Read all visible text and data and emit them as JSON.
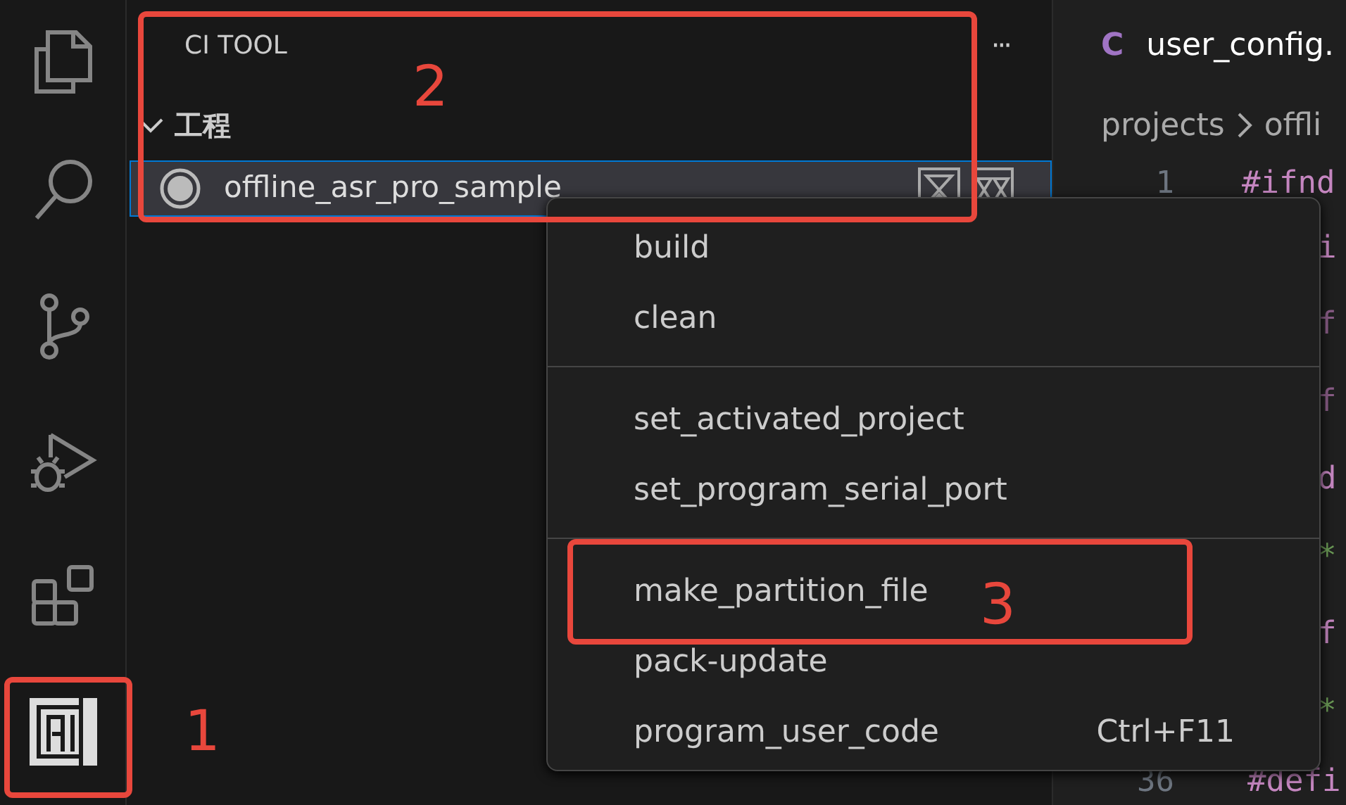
{
  "activity_bar": {
    "items": [
      {
        "kind": "files",
        "selected": false
      },
      {
        "kind": "search",
        "selected": false
      },
      {
        "kind": "source-control",
        "selected": false
      },
      {
        "kind": "run-debug",
        "selected": false
      },
      {
        "kind": "extensions",
        "selected": false
      },
      {
        "kind": "ci-tool",
        "selected": true
      }
    ]
  },
  "sidebar": {
    "title": "CI TOOL",
    "more": "···",
    "section": {
      "label": "工程",
      "expanded": true,
      "items": [
        {
          "label": "offline_asr_pro_sample",
          "selected": true
        }
      ]
    }
  },
  "editor": {
    "tab": {
      "icon": "C",
      "label": "user_config."
    },
    "breadcrumb": [
      "projects",
      "offli"
    ],
    "first_line": {
      "number": "1",
      "text": "#ifnd"
    },
    "fragments": [
      {
        "text": "i",
        "kind": "directive"
      },
      {
        "text": "f",
        "kind": "faded"
      },
      {
        "text": "f",
        "kind": "faded"
      },
      {
        "text": "d",
        "kind": "directive"
      },
      {
        "text": "*",
        "kind": "comment"
      },
      {
        "text": "f",
        "kind": "directive"
      },
      {
        "text": "*",
        "kind": "comment"
      },
      {
        "number": "36",
        "text": "#defi",
        "kind": "directive"
      }
    ]
  },
  "context_menu": {
    "groups": [
      [
        {
          "label": "build"
        },
        {
          "label": "clean"
        }
      ],
      [
        {
          "label": "set_activated_project"
        },
        {
          "label": "set_program_serial_port"
        }
      ],
      [
        {
          "label": "make_partition_file"
        },
        {
          "label": "pack-update"
        },
        {
          "label": "program_user_code",
          "shortcut": "Ctrl+F11"
        }
      ]
    ]
  },
  "annotations": [
    {
      "label": "1"
    },
    {
      "label": "2"
    },
    {
      "label": "3"
    }
  ]
}
